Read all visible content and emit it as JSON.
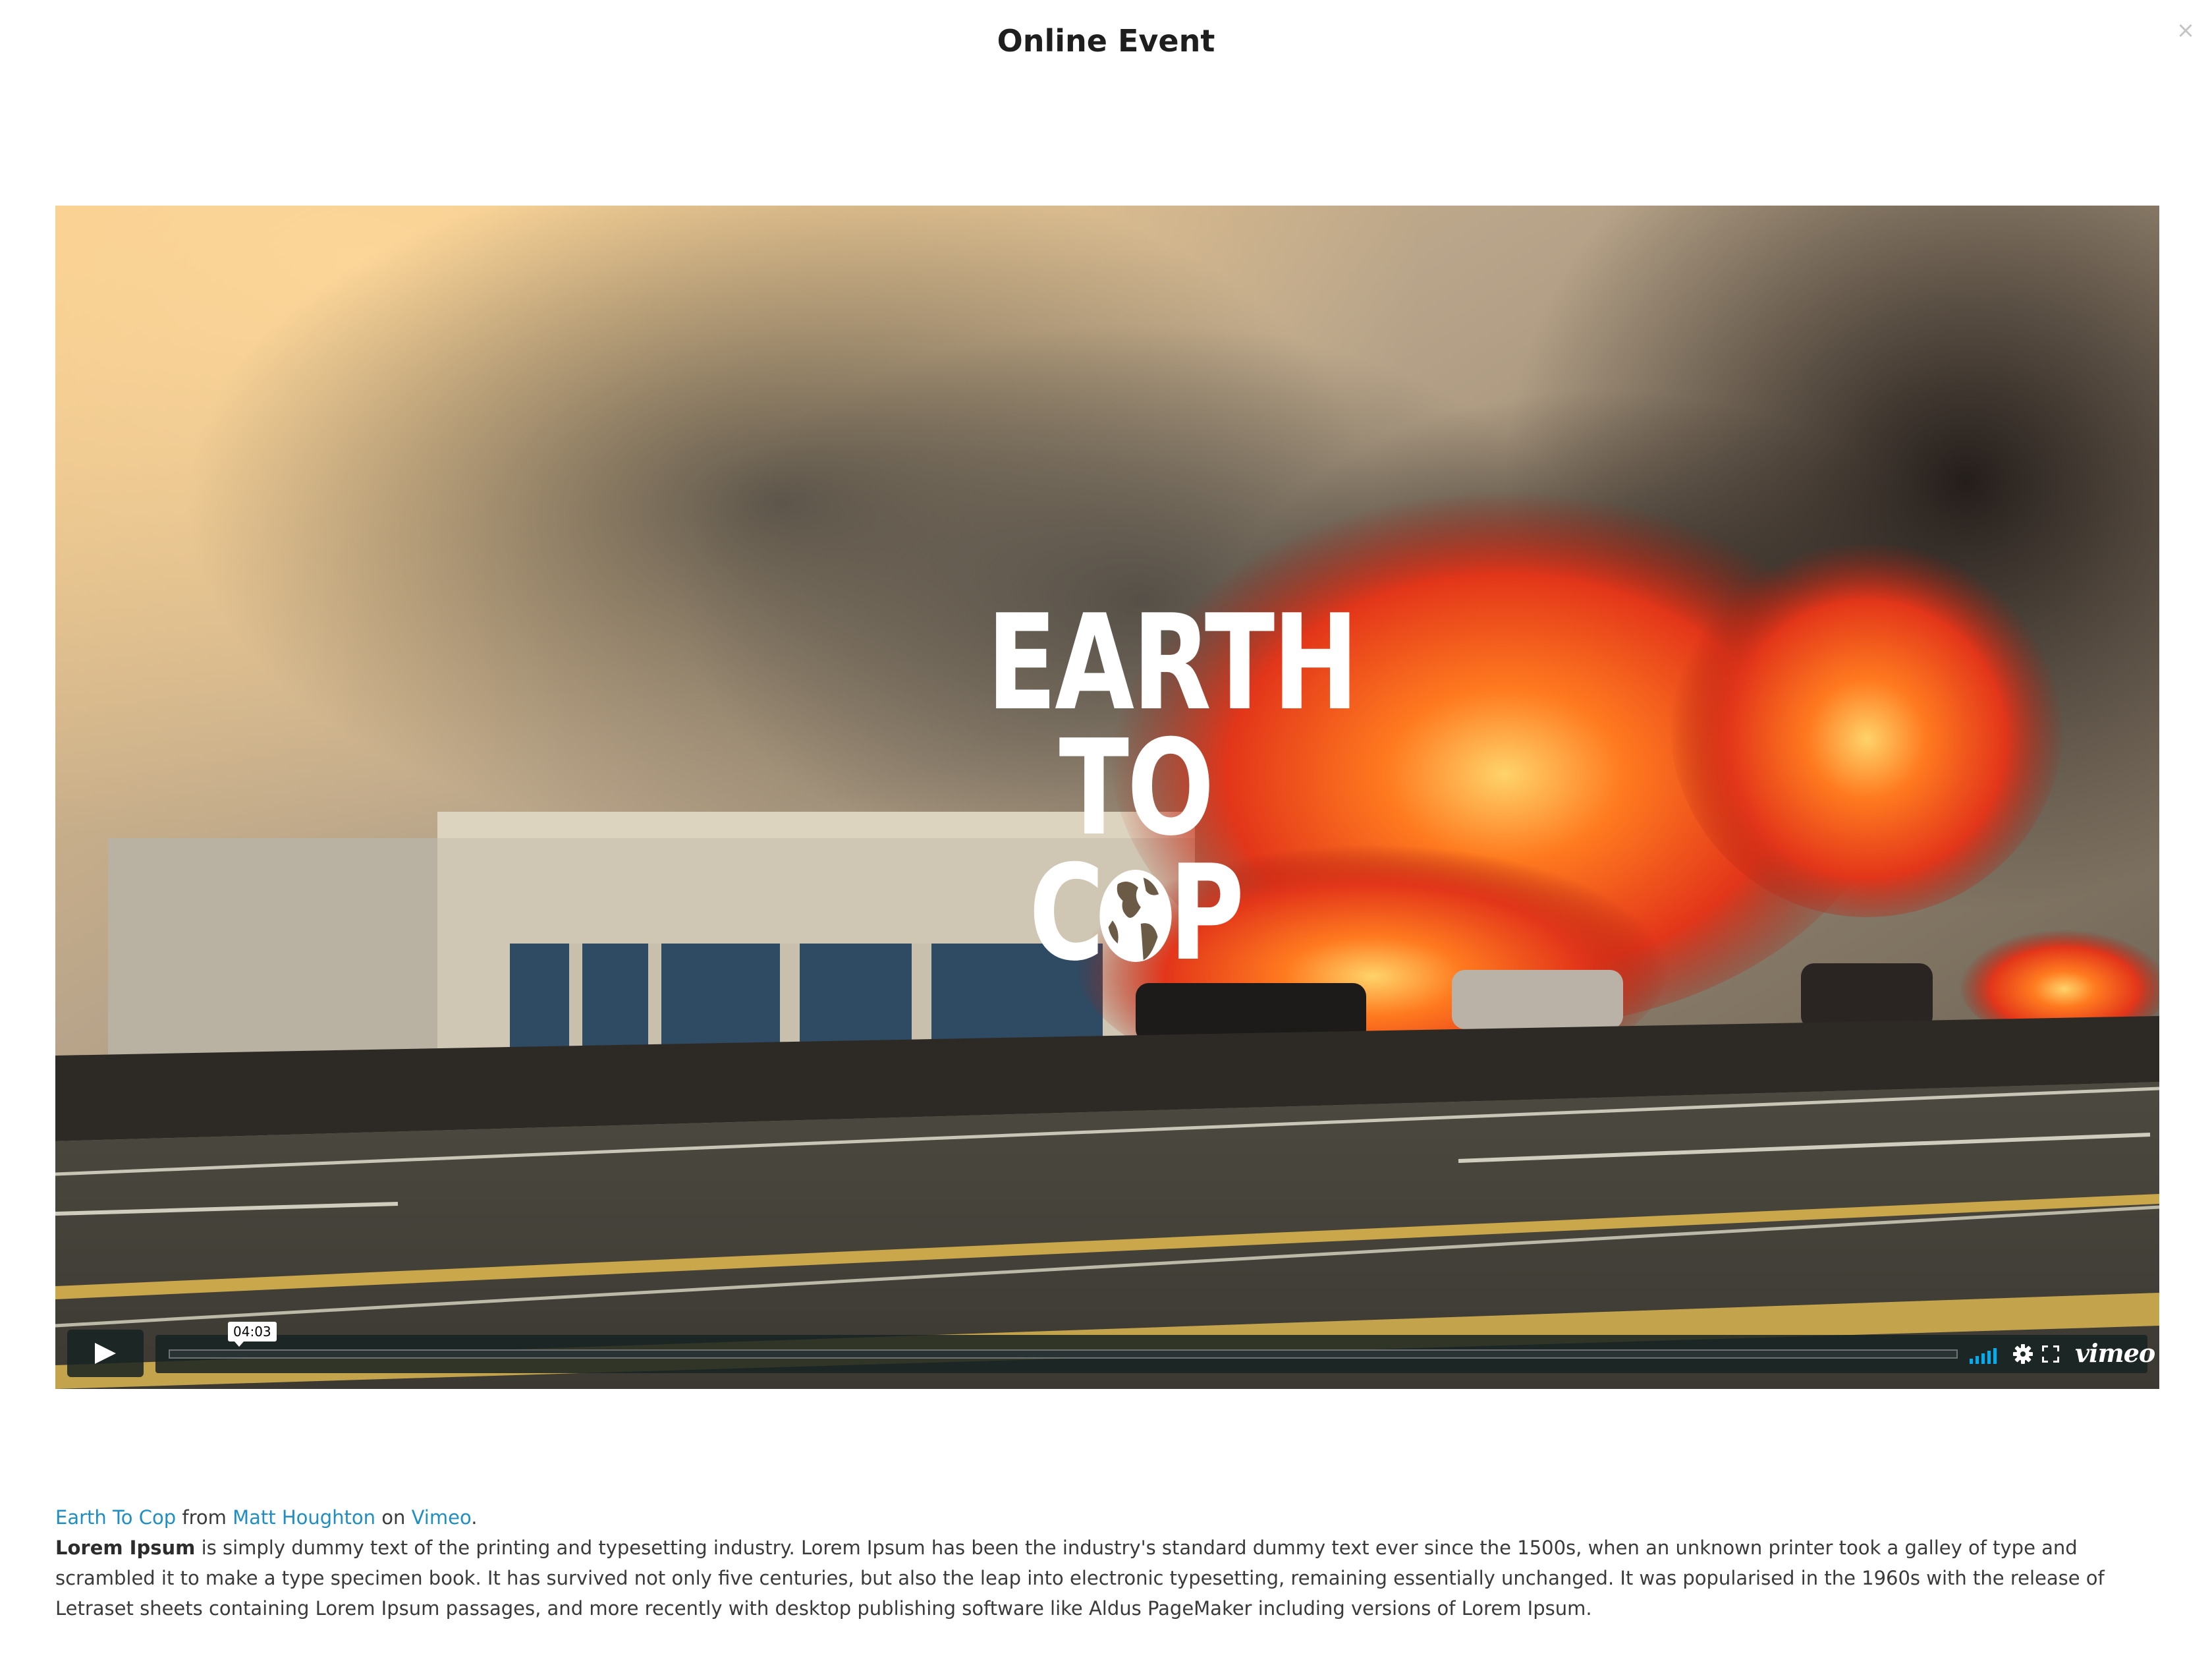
{
  "modal": {
    "title": "Online Event",
    "close_label": "×"
  },
  "video": {
    "title_card": {
      "line1": "EARTH",
      "line2": "TO",
      "line3_left": "C",
      "line3_right": "P"
    },
    "player": {
      "time_tooltip": "04:03",
      "progress_fraction": 0,
      "logo_text": "vimeo"
    }
  },
  "description": {
    "video_link": "Earth To Cop",
    "from_text": " from ",
    "author_link": "Matt Houghton",
    "on_text": " on ",
    "platform_link": "Vimeo",
    "period": ".",
    "bold_lead": "Lorem Ipsum",
    "body": " is simply dummy text of the printing and typesetting industry. Lorem Ipsum has been the industry's standard dummy text ever since the 1500s, when an unknown printer took a galley of type and scrambled it to make a type specimen book. It has survived not only five centuries, but also the leap into electronic typesetting, remaining essentially unchanged. It was popularised in the 1960s with the release of Letraset sheets containing Lorem Ipsum passages, and more recently with desktop publishing software like Aldus PageMaker including versions of Lorem Ipsum."
  },
  "colors": {
    "link": "#1f8ec5",
    "title": "#1e1e1e",
    "control_bg": "#172322",
    "vimeo_volume": "#00adef"
  },
  "icons": [
    "close-icon",
    "play-icon",
    "volume-icon",
    "settings-icon",
    "fullscreen-icon",
    "globe-icon"
  ]
}
